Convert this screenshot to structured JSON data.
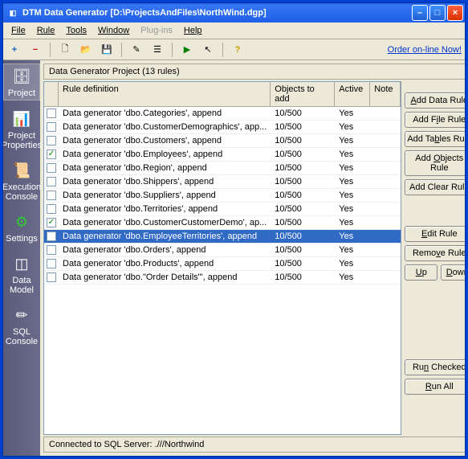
{
  "window": {
    "title": "DTM Data Generator [D:\\ProjectsAndFiles\\NorthWind.dgp]"
  },
  "menu": {
    "file": "File",
    "rule": "Rule",
    "tools": "Tools",
    "window": "Window",
    "plugins": "Plug-ins",
    "help": "Help"
  },
  "toolbar_link": "Order on-line Now!",
  "sidebar": [
    {
      "key": "project",
      "label": "Project"
    },
    {
      "key": "properties",
      "label": "Project Properties"
    },
    {
      "key": "execution",
      "label": "Execution Console"
    },
    {
      "key": "settings",
      "label": "Settings"
    },
    {
      "key": "datamodel",
      "label": "Data Model"
    },
    {
      "key": "sqlconsole",
      "label": "SQL Console"
    }
  ],
  "panel_title": "Data Generator Project (13 rules)",
  "columns": {
    "c1": "Rule definition",
    "c2": "Objects to add",
    "c3": "Active",
    "c4": "Note"
  },
  "rows": [
    {
      "checked": false,
      "selected": false,
      "def": "Data generator 'dbo.Categories', append",
      "obj": "10/500",
      "active": "Yes",
      "note": ""
    },
    {
      "checked": false,
      "selected": false,
      "def": "Data generator 'dbo.CustomerDemographics', app...",
      "obj": "10/500",
      "active": "Yes",
      "note": ""
    },
    {
      "checked": false,
      "selected": false,
      "def": "Data generator 'dbo.Customers', append",
      "obj": "10/500",
      "active": "Yes",
      "note": ""
    },
    {
      "checked": true,
      "selected": false,
      "def": "Data generator 'dbo.Employees', append",
      "obj": "10/500",
      "active": "Yes",
      "note": ""
    },
    {
      "checked": false,
      "selected": false,
      "def": "Data generator 'dbo.Region', append",
      "obj": "10/500",
      "active": "Yes",
      "note": ""
    },
    {
      "checked": false,
      "selected": false,
      "def": "Data generator 'dbo.Shippers', append",
      "obj": "10/500",
      "active": "Yes",
      "note": ""
    },
    {
      "checked": false,
      "selected": false,
      "def": "Data generator 'dbo.Suppliers', append",
      "obj": "10/500",
      "active": "Yes",
      "note": ""
    },
    {
      "checked": false,
      "selected": false,
      "def": "Data generator 'dbo.Territories', append",
      "obj": "10/500",
      "active": "Yes",
      "note": ""
    },
    {
      "checked": true,
      "selected": false,
      "def": "Data generator 'dbo.CustomerCustomerDemo', ap...",
      "obj": "10/500",
      "active": "Yes",
      "note": ""
    },
    {
      "checked": false,
      "selected": true,
      "def": "Data generator 'dbo.EmployeeTerritories', append",
      "obj": "10/500",
      "active": "Yes",
      "note": ""
    },
    {
      "checked": false,
      "selected": false,
      "def": "Data generator 'dbo.Orders', append",
      "obj": "10/500",
      "active": "Yes",
      "note": ""
    },
    {
      "checked": false,
      "selected": false,
      "def": "Data generator 'dbo.Products', append",
      "obj": "10/500",
      "active": "Yes",
      "note": ""
    },
    {
      "checked": false,
      "selected": false,
      "def": "Data generator 'dbo.\"Order Details\"', append",
      "obj": "10/500",
      "active": "Yes",
      "note": ""
    }
  ],
  "buttons": {
    "add_data": "Add Data Rule",
    "add_file": "Add File Rule",
    "add_tables": "Add Tables Rule",
    "add_objects": "Add Objects Rule",
    "add_clear": "Add Clear Rule",
    "edit": "Edit Rule",
    "remove": "Remove Rule",
    "up": "Up",
    "down": "Down",
    "run_checked": "Run Checked",
    "run_all": "Run All"
  },
  "status": "Connected to SQL Server: .///Northwind"
}
